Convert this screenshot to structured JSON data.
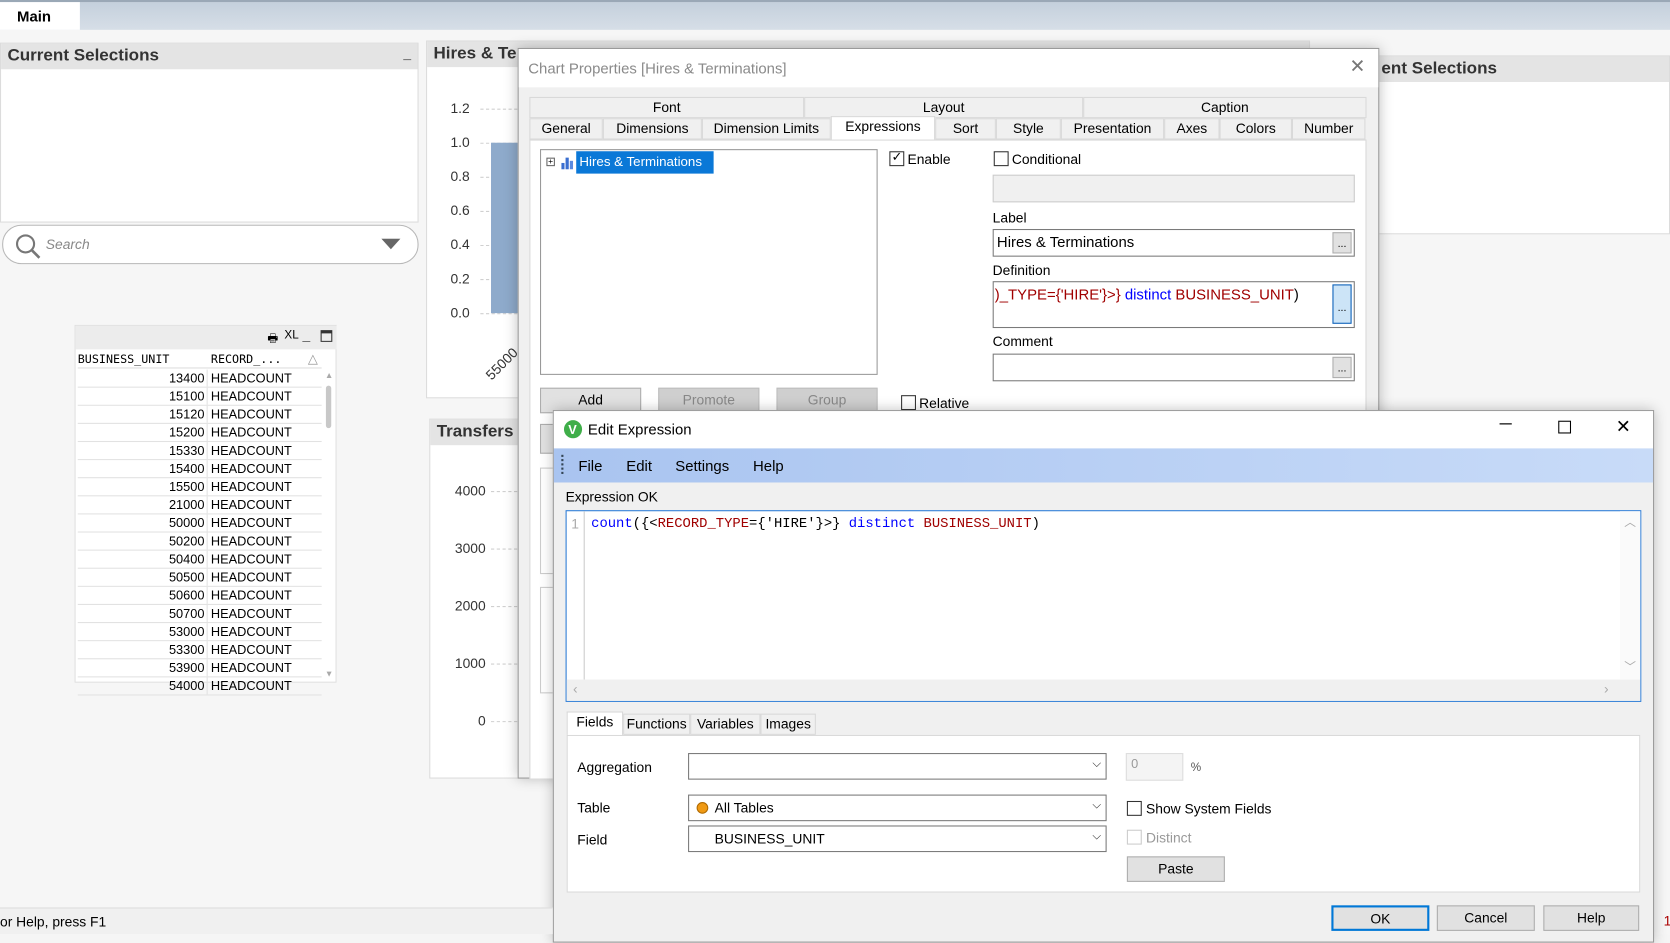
{
  "app": {
    "sheet_tab": "Main",
    "status": "or Help, press F1",
    "status_right": "1"
  },
  "current_selections": {
    "title": "Current Selections",
    "minimize": "_"
  },
  "search": {
    "placeholder": "Search"
  },
  "table": {
    "toolbar": [
      "XL"
    ],
    "columns": [
      "BUSINESS_UNIT",
      "RECORD_..."
    ],
    "rows": [
      [
        "13400",
        "HEADCOUNT"
      ],
      [
        "15100",
        "HEADCOUNT"
      ],
      [
        "15120",
        "HEADCOUNT"
      ],
      [
        "15200",
        "HEADCOUNT"
      ],
      [
        "15330",
        "HEADCOUNT"
      ],
      [
        "15400",
        "HEADCOUNT"
      ],
      [
        "15500",
        "HEADCOUNT"
      ],
      [
        "21000",
        "HEADCOUNT"
      ],
      [
        "50000",
        "HEADCOUNT"
      ],
      [
        "50200",
        "HEADCOUNT"
      ],
      [
        "50400",
        "HEADCOUNT"
      ],
      [
        "50500",
        "HEADCOUNT"
      ],
      [
        "50600",
        "HEADCOUNT"
      ],
      [
        "50700",
        "HEADCOUNT"
      ],
      [
        "53000",
        "HEADCOUNT"
      ],
      [
        "53300",
        "HEADCOUNT"
      ],
      [
        "53900",
        "HEADCOUNT"
      ],
      [
        "54000",
        "HEADCOUNT"
      ]
    ]
  },
  "hires_chart": {
    "title": "Hires & Te",
    "yticks": [
      "1.2",
      "1.0",
      "0.8",
      "0.6",
      "0.4",
      "0.2",
      "0.0"
    ],
    "xlabel": "55000",
    "bar_value": 1.0,
    "bar_color": "#8eaacb"
  },
  "transfers_chart": {
    "title": "Transfers",
    "yticks": [
      "4000",
      "3000",
      "2000",
      "1000",
      "0"
    ]
  },
  "right_selections": {
    "title": "ent Selections"
  },
  "chart_properties": {
    "title": "Chart Properties [Hires & Terminations]",
    "tab_row1": [
      "Font",
      "Layout",
      "Caption"
    ],
    "tab_row2": [
      "General",
      "Dimensions",
      "Dimension Limits",
      "Expressions",
      "Sort",
      "Style",
      "Presentation",
      "Axes",
      "Colors",
      "Number"
    ],
    "selected_tab": "Expressions",
    "tree_item": "Hires & Terminations",
    "enable_label": "Enable",
    "enable_checked": true,
    "conditional_label": "Conditional",
    "conditional_checked": false,
    "label_caption": "Label",
    "label_value": "Hires & Terminations",
    "definition_caption": "Definition",
    "definition_parts": [
      ")_TYPE={'HIRE'}>} ",
      "distinct",
      " BUSINESS_UNIT",
      ")"
    ],
    "comment_caption": "Comment",
    "dots": "...",
    "buttons": {
      "add": "Add",
      "promote": "Promote",
      "group": "Group"
    },
    "relative_label": "Relative"
  },
  "edit_expression": {
    "title": "Edit Expression",
    "menu": [
      "File",
      "Edit",
      "Settings",
      "Help"
    ],
    "status": "Expression OK",
    "line_number": "1",
    "code": {
      "fn": "count",
      "p1": "({<",
      "field": "RECORD_TYPE",
      "p2": "={'HIRE'}>} ",
      "kw": "distinct",
      "field2": " BUSINESS_UNIT",
      "p3": ")"
    },
    "tabs": [
      "Fields",
      "Functions",
      "Variables",
      "Images"
    ],
    "aggregation_label": "Aggregation",
    "aggregation_value": "",
    "percent_value": "0",
    "percent_sign": "%",
    "table_label": "Table",
    "table_value": "All Tables",
    "field_label": "Field",
    "field_value": "BUSINESS_UNIT",
    "show_system_fields": "Show System Fields",
    "distinct": "Distinct",
    "paste": "Paste",
    "ok": "OK",
    "cancel": "Cancel",
    "help": "Help",
    "colors": {
      "menu_bar": "#a9c4f0",
      "function": "#0000ff",
      "field": "#a00000",
      "accent": "#2a7ad5"
    }
  }
}
